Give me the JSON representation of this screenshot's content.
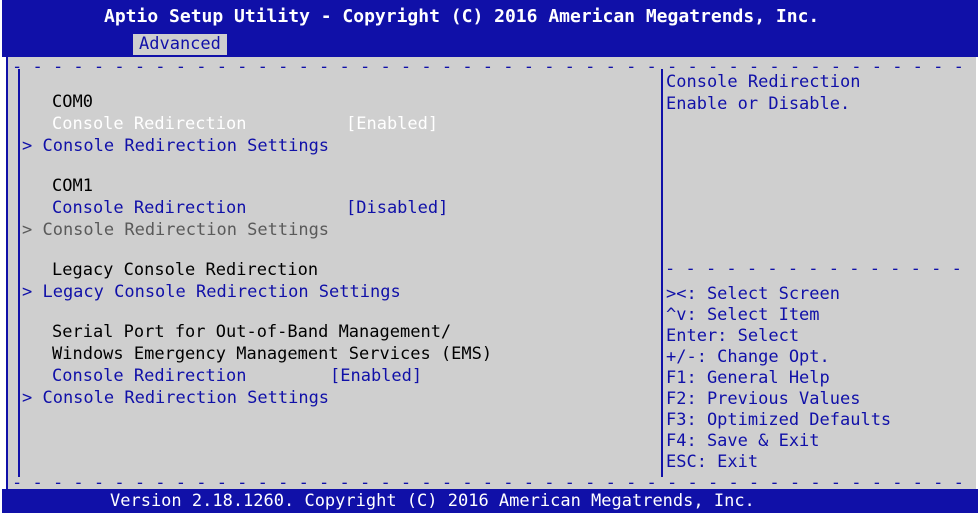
{
  "app": {
    "title": "Aptio Setup Utility - Copyright (C) 2016 American Megatrends, Inc.",
    "active_tab": "Advanced",
    "footer": "Version 2.18.1260. Copyright (C) 2016 American Megatrends, Inc."
  },
  "colors": {
    "bar_blue": "#1010a8",
    "panel_gray": "#cfcfcf",
    "selected_text": "#ffffff",
    "disabled_text": "#5a5a5a"
  },
  "menu": {
    "com0": {
      "header": "COM0",
      "redirection_label": "Console Redirection",
      "redirection_value": "[Enabled]",
      "settings_label": "> Console Redirection Settings"
    },
    "com1": {
      "header": "COM1",
      "redirection_label": "Console Redirection",
      "redirection_value": "[Disabled]",
      "settings_label": "> Console Redirection Settings"
    },
    "legacy": {
      "header": "Legacy Console Redirection",
      "settings_label": "> Legacy Console Redirection Settings"
    },
    "ems": {
      "header_line1": "Serial Port for Out-of-Band Management/",
      "header_line2": "Windows Emergency Management Services (EMS)",
      "redirection_label": "Console Redirection",
      "redirection_value": "[Enabled]",
      "settings_label": "> Console Redirection Settings"
    }
  },
  "help": {
    "description_line1": "Console Redirection",
    "description_line2": "Enable or Disable.",
    "keys": [
      "><: Select Screen",
      "^v: Select Item",
      "Enter: Select",
      "+/-: Change Opt.",
      "F1: General Help",
      "F2: Previous Values",
      "F3: Optimized Defaults",
      "F4: Save & Exit",
      "ESC: Exit"
    ]
  }
}
